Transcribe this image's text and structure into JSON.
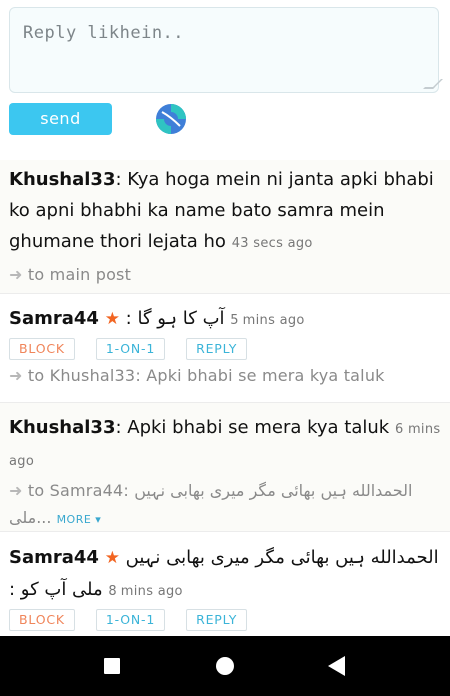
{
  "composer": {
    "placeholder": "Reply likhein..",
    "send_label": "send"
  },
  "posts": [
    {
      "user": "Khushal33",
      "text": ": Kya hoga mein ni janta apki bhabi ko apni bhabhi ka name bato samra mein ghumane thori lejata ho",
      "time": "43 secs ago",
      "ref": "to main post"
    },
    {
      "user": "Samra44",
      "text": "آپ کا ہو گا :",
      "time": "5 mins ago",
      "actions": {
        "block": "BLOCK",
        "one_on_one": "1-ON-1",
        "reply": "REPLY"
      },
      "ref": "to Khushal33: Apki bhabi se mera kya taluk"
    },
    {
      "user": "Khushal33",
      "text": ": Apki bhabi se mera kya taluk",
      "time": "6 mins ago",
      "ref": "to Samra44: الحمدالله ہیں بھائی مگر میری بھابی نہیں ملی...",
      "more": "MORE ▾"
    },
    {
      "user": "Samra44",
      "text": "الحمدالله ہیں بھائی مگر میری بھابی نہیں ملی آپ کو :",
      "time": "8 mins ago",
      "actions": {
        "block": "BLOCK",
        "one_on_one": "1-ON-1",
        "reply": "REPLY"
      }
    }
  ]
}
